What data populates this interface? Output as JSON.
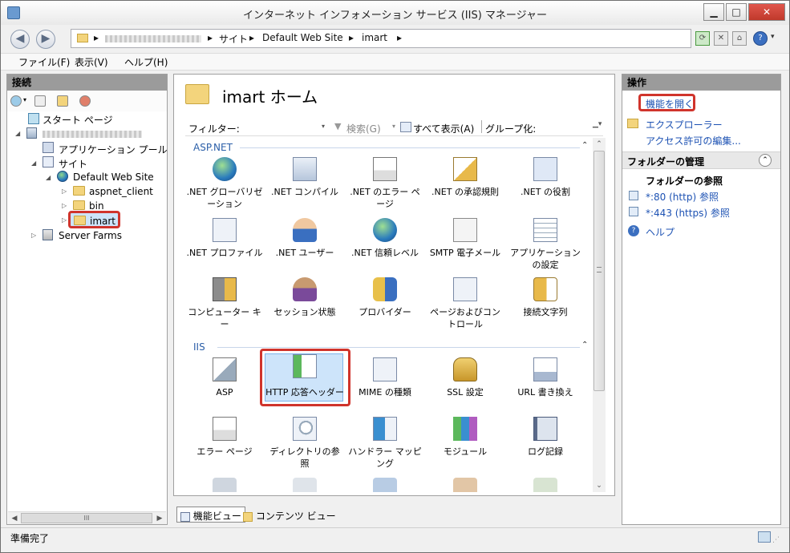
{
  "window": {
    "title": "インターネット インフォメーション サービス (IIS) マネージャー"
  },
  "nav": {
    "crumbs": [
      "サイト",
      "Default Web Site",
      "imart"
    ],
    "help_label": "?"
  },
  "menu": {
    "items": [
      "ファイル(F)",
      "表示(V)",
      "ヘルプ(H)"
    ]
  },
  "connections": {
    "header": "接続",
    "tree": {
      "start_page": "スタート ページ",
      "app_pools": "アプリケーション プール",
      "sites": "サイト",
      "default_site": "Default Web Site",
      "aspnet_client": "aspnet_client",
      "bin": "bin",
      "imart": "imart",
      "server_farms": "Server Farms"
    },
    "scroll_mid": "III"
  },
  "center": {
    "title": "imart ホーム",
    "filter_label": "フィルター:",
    "search_label": "検索(G)",
    "show_all_label": "すべて表示(A)",
    "group_by_label": "グループ化:",
    "groups": [
      {
        "name": "ASP.NET",
        "tiles": [
          ".NET グローバリゼーション",
          ".NET コンパイル",
          ".NET のエラー ページ",
          ".NET の承認規則",
          ".NET の役割",
          ".NET プロファイル",
          ".NET ユーザー",
          ".NET 信頼レベル",
          "SMTP 電子メール",
          "アプリケーションの設定",
          "コンピューター キー",
          "セッション状態",
          "プロバイダー",
          "ページおよびコントロール",
          "接続文字列"
        ]
      },
      {
        "name": "IIS",
        "tiles": [
          "ASP",
          "HTTP 応答ヘッダー",
          "MIME の種類",
          "SSL 設定",
          "URL 書き換え",
          "エラー ページ",
          "ディレクトリの参照",
          "ハンドラー マッピング",
          "モジュール",
          "ログ記録"
        ]
      }
    ],
    "view_tabs": [
      "機能ビュー",
      "コンテンツ ビュー"
    ]
  },
  "actions": {
    "header": "操作",
    "open_feature": "機能を開く",
    "explorer": "エクスプローラー",
    "edit_permissions": "アクセス許可の編集...",
    "manage_folder": "フォルダーの管理",
    "browse_folder": "フォルダーの参照",
    "browse_http": "*:80 (http) 参照",
    "browse_https": "*:443 (https) 参照",
    "help": "ヘルプ"
  },
  "status": {
    "text": "準備完了"
  },
  "colors": {
    "link": "#1d52b3",
    "highlight": "#d0342c",
    "group_header": "#2b5fa8"
  }
}
